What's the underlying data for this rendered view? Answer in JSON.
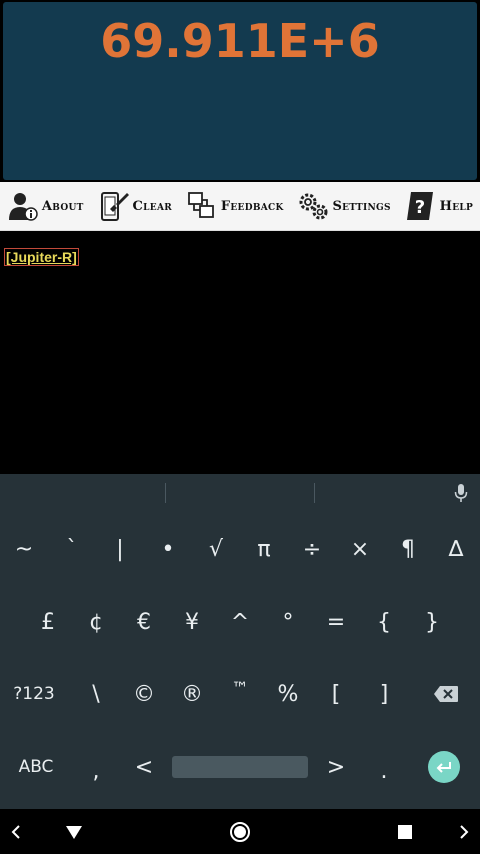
{
  "display": {
    "value": "69.911E+6"
  },
  "toolbar": {
    "about": "About",
    "clear": "Clear",
    "feedback": "Feedback",
    "settings": "Settings",
    "help": "Help"
  },
  "workarea": {
    "tag": "[Jupiter-R]"
  },
  "keyboard": {
    "row1": [
      "~",
      "`",
      "|",
      "•",
      "√",
      "π",
      "÷",
      "×",
      "¶",
      "∆"
    ],
    "row2": [
      "£",
      "¢",
      "€",
      "¥",
      "^",
      "°",
      "=",
      "{",
      "}"
    ],
    "row3": [
      "?123",
      "\\",
      "©",
      "®",
      "™",
      "%",
      "[",
      "]"
    ],
    "row4": [
      "ABC",
      ",",
      "<",
      ">",
      "."
    ]
  },
  "colors": {
    "display_bg": "#133a4f",
    "display_text": "#e07437",
    "keyboard_bg": "#263238",
    "enter_key": "#7ad6c6"
  }
}
